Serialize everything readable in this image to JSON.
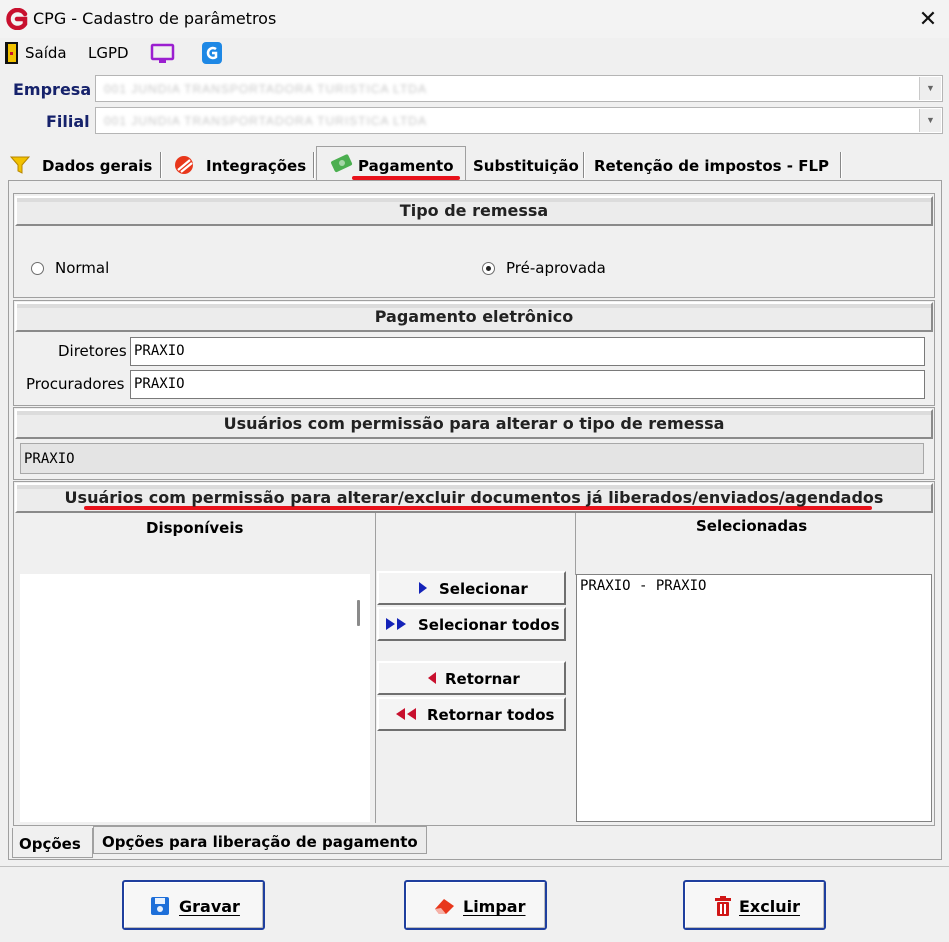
{
  "window": {
    "title": "CPG - Cadastro de parâmetros",
    "close_glyph": "✕"
  },
  "toolbar": {
    "saida_label": "Saída",
    "lgpd_label": "LGPD"
  },
  "company": {
    "empresa_label": "Empresa",
    "empresa_value": "001 JUNDIA TRANSPORTADORA TURISTICA LTDA",
    "filial_label": "Filial",
    "filial_value": "001 JUNDIA TRANSPORTADORA TURISTICA LTDA"
  },
  "tabs": [
    {
      "label": "Dados gerais"
    },
    {
      "label": "Integrações"
    },
    {
      "label": "Pagamento",
      "active": true
    },
    {
      "label": "Substituição"
    },
    {
      "label": "Retenção de impostos - FLP"
    }
  ],
  "tipo_remessa": {
    "header": "Tipo de remessa",
    "options": [
      {
        "label": "Normal",
        "selected": false
      },
      {
        "label": "Pré-aprovada",
        "selected": true
      }
    ]
  },
  "pagamento_eletronico": {
    "header": "Pagamento eletrônico",
    "diretores_label": "Diretores",
    "diretores_value": "PRAXIO",
    "procuradores_label": "Procuradores",
    "procuradores_value": "PRAXIO"
  },
  "usuarios_remessa": {
    "header": "Usuários com permissão para alterar o tipo de remessa",
    "value": "PRAXIO"
  },
  "usuarios_documentos": {
    "header": "Usuários com permissão para alterar/excluir documentos já liberados/enviados/agendados",
    "disponiveis_label": "Disponíveis",
    "selecionadas_label": "Selecionadas",
    "selecionadas_items": [
      "PRAXIO - PRAXIO"
    ],
    "buttons": {
      "selecionar": "Selecionar",
      "selecionar_todos": "Selecionar todos",
      "retornar": "Retornar",
      "retornar_todos": "Retornar todos"
    }
  },
  "bottom_tabs": [
    {
      "label": "Opções",
      "active": true
    },
    {
      "label": "Opções para liberação de pagamento"
    }
  ],
  "actions": {
    "gravar": "Gravar",
    "limpar": "Limpar",
    "excluir": "Excluir"
  },
  "colors": {
    "accent_red": "#e8121b",
    "label_blue": "#16226b",
    "button_border": "#1f3f9e"
  }
}
